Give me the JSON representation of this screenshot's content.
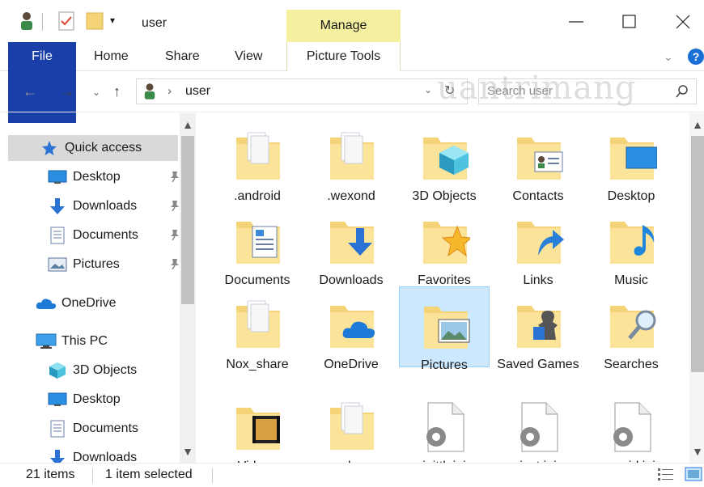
{
  "window": {
    "title": "user",
    "manage_tab": "Manage"
  },
  "ribbon": {
    "tabs": [
      "File",
      "Home",
      "Share",
      "View",
      "Picture Tools"
    ]
  },
  "address": {
    "path": "user",
    "search_placeholder": "Search user"
  },
  "watermark": "uantrimang",
  "nav": {
    "items": [
      {
        "label": "Quick access",
        "icon": "star-icon",
        "selected": true,
        "pinned": false
      },
      {
        "label": "Desktop",
        "icon": "desktop-icon",
        "pinned": true
      },
      {
        "label": "Downloads",
        "icon": "download-icon",
        "pinned": true
      },
      {
        "label": "Documents",
        "icon": "document-icon",
        "pinned": true
      },
      {
        "label": "Pictures",
        "icon": "pictures-icon",
        "pinned": true
      },
      {
        "label": "OneDrive",
        "icon": "cloud-icon",
        "pinned": false
      },
      {
        "label": "This PC",
        "icon": "computer-icon",
        "pinned": false
      },
      {
        "label": "3D Objects",
        "icon": "cube-icon",
        "pinned": false
      },
      {
        "label": "Desktop",
        "icon": "desktop-icon",
        "pinned": false
      },
      {
        "label": "Documents",
        "icon": "document-icon",
        "pinned": false
      },
      {
        "label": "Downloads",
        "icon": "download-icon",
        "pinned": false
      }
    ]
  },
  "files": [
    {
      "label": ".android",
      "kind": "folder-doc"
    },
    {
      "label": ".wexond",
      "kind": "folder-doc"
    },
    {
      "label": "3D Objects",
      "kind": "folder-3d"
    },
    {
      "label": "Contacts",
      "kind": "folder-contacts"
    },
    {
      "label": "Desktop",
      "kind": "folder-desktop"
    },
    {
      "label": "Documents",
      "kind": "folder-documents"
    },
    {
      "label": "Downloads",
      "kind": "folder-downloads"
    },
    {
      "label": "Favorites",
      "kind": "folder-star"
    },
    {
      "label": "Links",
      "kind": "folder-link"
    },
    {
      "label": "Music",
      "kind": "folder-music"
    },
    {
      "label": "Nox_share",
      "kind": "folder-doc"
    },
    {
      "label": "OneDrive",
      "kind": "folder-cloud"
    },
    {
      "label": "Pictures",
      "kind": "folder-pictures",
      "selected": true
    },
    {
      "label": "Saved Games",
      "kind": "folder-games"
    },
    {
      "label": "Searches",
      "kind": "folder-search"
    },
    {
      "label": "Videos",
      "kind": "folder-video"
    },
    {
      "label": "vmlogs",
      "kind": "folder-doc"
    },
    {
      "label": "inittk.ini",
      "kind": "ini"
    },
    {
      "label": "inst.ini",
      "kind": "ini"
    },
    {
      "label": "nuuid.ini",
      "kind": "ini"
    }
  ],
  "status": {
    "count": "21 items",
    "selection": "1 item selected"
  }
}
